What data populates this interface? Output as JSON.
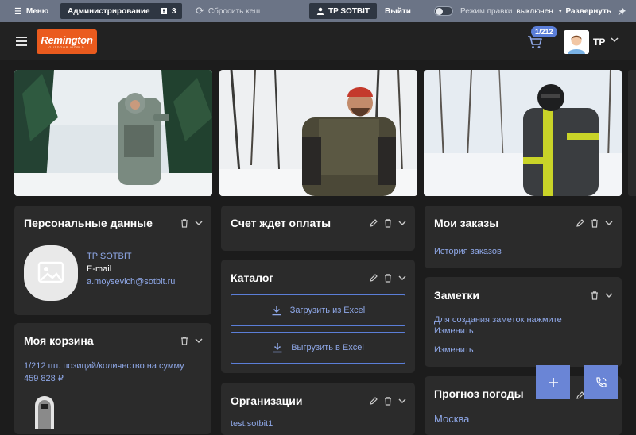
{
  "admin_bar": {
    "menu_label": "Меню",
    "admin_label": "Администрирование",
    "notif_count": "3",
    "reset_cache_label": "Сбросить кеш",
    "user_label": "TP SOTBIT",
    "logout_label": "Выйти",
    "edit_mode_label": "Режим правки",
    "edit_mode_state": "выключен",
    "expand_label": "Развернуть"
  },
  "header": {
    "logo_text": "Remington",
    "logo_subtext": "OUTDOOR WORLD",
    "cart_badge": "1/212",
    "user_initials": "TP"
  },
  "widgets": {
    "personal": {
      "title": "Персональные данные",
      "name": "TP SOTBIT",
      "email_label": "E-mail",
      "email": "a.moysevich@sotbit.ru"
    },
    "cart": {
      "title": "Моя корзина",
      "summary": "1/212 шт. позиций/количество на сумму 459 828 ₽"
    },
    "invoice": {
      "title": "Счет ждет оплаты"
    },
    "catalog": {
      "title": "Каталог",
      "upload_label": "Загрузить из Excel",
      "download_label": "Выгрузить в Excel"
    },
    "orgs": {
      "title": "Организации",
      "first_item": "test.sotbit1"
    },
    "orders": {
      "title": "Мои заказы",
      "history_link": "История заказов"
    },
    "notes": {
      "title": "Заметки",
      "hint": "Для создания заметок нажмите",
      "edit_link": "Изменить",
      "edit_link2": "Изменить"
    },
    "weather": {
      "title": "Прогноз погоды",
      "city": "Москва"
    }
  },
  "colors": {
    "accent": "#5b7ed8",
    "brand": "#ea5b1e",
    "admin_bar": "#6b7486",
    "card": "#2b2b2b",
    "background": "#1c1c1c"
  }
}
